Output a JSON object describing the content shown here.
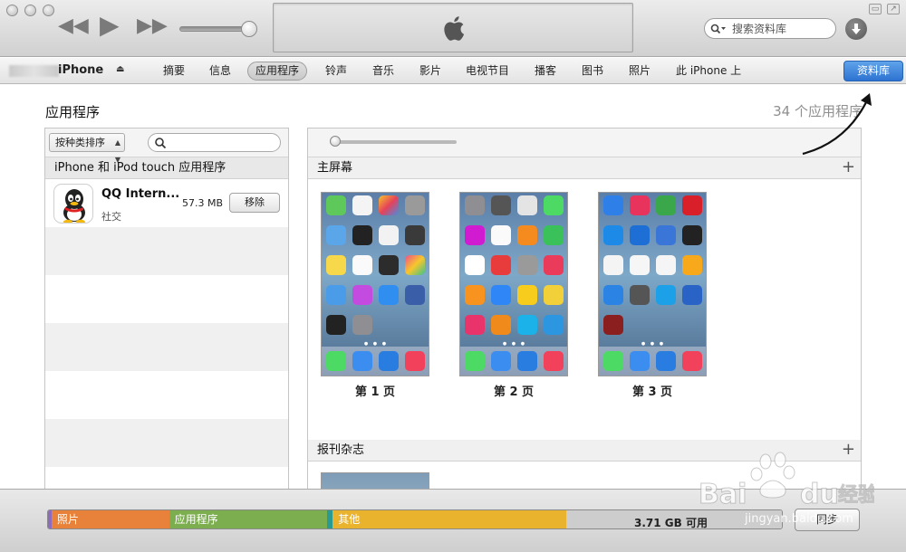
{
  "toolbar": {
    "search_placeholder": "搜索资料库"
  },
  "device": {
    "name": "iPhone"
  },
  "nav": {
    "tabs": [
      {
        "label": "摘要"
      },
      {
        "label": "信息"
      },
      {
        "label": "应用程序",
        "active": true
      },
      {
        "label": "铃声"
      },
      {
        "label": "音乐"
      },
      {
        "label": "影片"
      },
      {
        "label": "电视节目"
      },
      {
        "label": "播客"
      },
      {
        "label": "图书"
      },
      {
        "label": "照片"
      },
      {
        "label": "此 iPhone 上"
      }
    ],
    "library_button": "资料库"
  },
  "main": {
    "title": "应用程序",
    "count": "34 个应用程序"
  },
  "left_panel": {
    "sort_label": "按种类排序",
    "header": "iPhone 和 iPod touch 应用程序",
    "apps": [
      {
        "name": "QQ Intern...",
        "category": "社交",
        "size": "57.3 MB",
        "action": "移除"
      }
    ]
  },
  "right_panel": {
    "home_screen_title": "主屏幕",
    "pages": [
      {
        "label": "第 1 页"
      },
      {
        "label": "第 2 页"
      },
      {
        "label": "第 3 页"
      }
    ],
    "newsstand_title": "报刊杂志"
  },
  "capacity": {
    "segments": [
      {
        "label": "",
        "color": "#8d6bbf",
        "fraction": 0.005
      },
      {
        "label": "照片",
        "color": "#e8823a",
        "fraction": 0.16
      },
      {
        "label": "应用程序",
        "color": "#7cae4f",
        "fraction": 0.215
      },
      {
        "label": "",
        "color": "#2a9a92",
        "fraction": 0.008
      },
      {
        "label": "其他",
        "color": "#eab32e",
        "fraction": 0.318
      },
      {
        "label": "",
        "color": "#cdcdcd",
        "fraction": 0.294
      }
    ],
    "free": "3.71 GB 可用",
    "sync_button": "同步"
  },
  "watermark": {
    "url": "jingyan.baidu.com"
  }
}
